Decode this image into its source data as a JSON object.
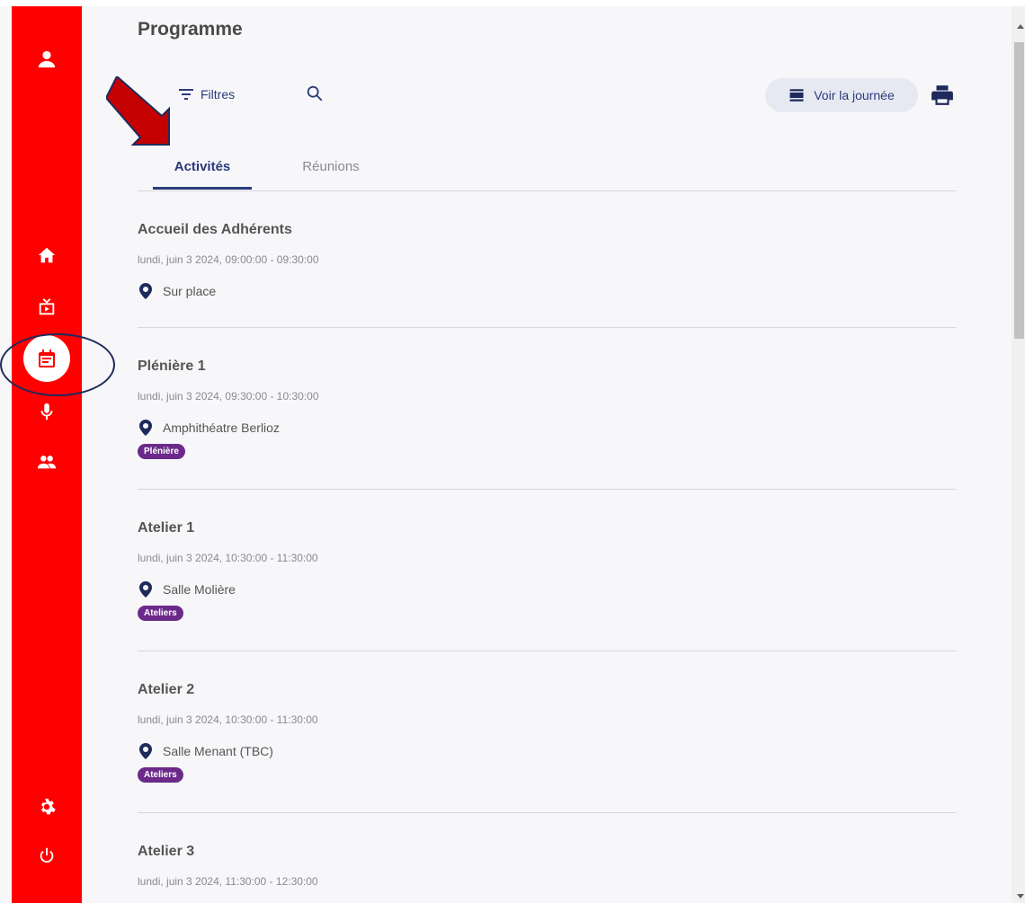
{
  "page": {
    "title": "Programme"
  },
  "sidebar": {
    "icons": [
      "user-icon",
      "home-icon",
      "tv-icon",
      "calendar-icon",
      "microphone-icon",
      "people-icon",
      "gear-icon",
      "power-icon"
    ],
    "active": "calendar-icon"
  },
  "toolbar": {
    "filter_label": "Filtres",
    "voir_label": "Voir la journée"
  },
  "tabs": [
    {
      "label": "Activités",
      "active": true
    },
    {
      "label": "Réunions",
      "active": false
    }
  ],
  "activities": [
    {
      "title": "Accueil des Adhérents",
      "date": "lundi, juin 3 2024, 09:00:00 - 09:30:00",
      "location": "Sur place",
      "tag": ""
    },
    {
      "title": "Plénière 1",
      "date": "lundi, juin 3 2024, 09:30:00 - 10:30:00",
      "location": "Amphithéatre Berlioz",
      "tag": "Plénière"
    },
    {
      "title": "Atelier 1",
      "date": "lundi, juin 3 2024, 10:30:00 - 11:30:00",
      "location": "Salle Molière",
      "tag": "Ateliers"
    },
    {
      "title": "Atelier 2",
      "date": "lundi, juin 3 2024, 10:30:00 - 11:30:00",
      "location": "Salle Menant (TBC)",
      "tag": "Ateliers"
    },
    {
      "title": "Atelier 3",
      "date": "lundi, juin 3 2024, 11:30:00 - 12:30:00",
      "location": "",
      "tag": ""
    }
  ],
  "colors": {
    "sidebar": "#ff0000",
    "accent": "#2a3a7a",
    "tag": "#6b2a8a"
  }
}
